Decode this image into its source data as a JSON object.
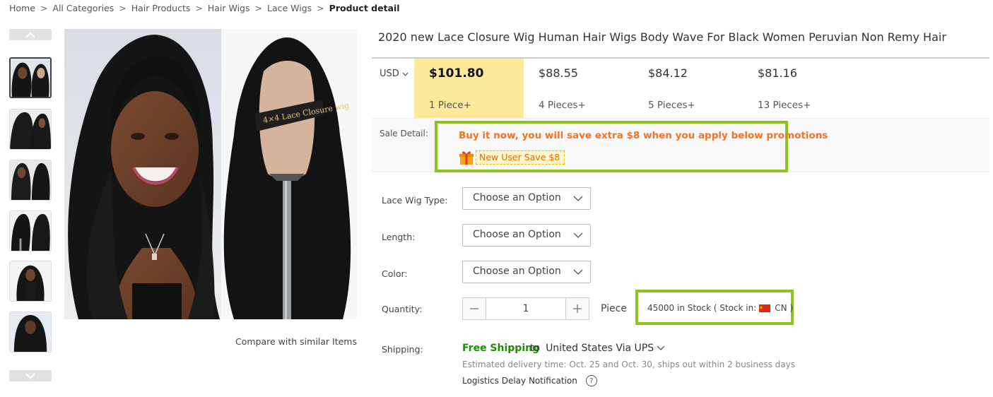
{
  "breadcrumb": {
    "items": [
      "Home",
      "All Categories",
      "Hair Products",
      "Hair Wigs",
      "Lace Wigs"
    ],
    "current": "Product detail",
    "separator": ">"
  },
  "gallery": {
    "thumbnail_count": 6,
    "active_index": 0,
    "main_image_label": "4×4 Lace Closure wig",
    "compare_link": "Compare with similar Items"
  },
  "product": {
    "title": "2020 new Lace Closure Wig Human Hair Wigs Body Wave For Black Women Peruvian Non Remy Hair"
  },
  "pricing": {
    "currency": "USD",
    "tiers": [
      {
        "price": "$101.80",
        "qty": "1 Piece+"
      },
      {
        "price": "$88.55",
        "qty": "4 Pieces+"
      },
      {
        "price": "$84.12",
        "qty": "5 Pieces+"
      },
      {
        "price": "$81.16",
        "qty": "13 Pieces+"
      }
    ],
    "highlight_color": "#fce99a"
  },
  "sale": {
    "label": "Sale Detail:",
    "promo_text": "Buy it now, you will save extra $8 when you apply below promotions",
    "coupon": "New User Save $8",
    "promo_color": "#f57224"
  },
  "options": {
    "lace_wig_type": {
      "label": "Lace Wig Type:",
      "value": "Choose an Option"
    },
    "length": {
      "label": "Length:",
      "value": "Choose an Option"
    },
    "color": {
      "label": "Color:",
      "value": "Choose an Option"
    }
  },
  "quantity": {
    "label": "Quantity:",
    "value": "1",
    "unit": "Piece",
    "stock_prefix": "45000 in Stock ( Stock in:",
    "stock_suffix": "CN )"
  },
  "shipping": {
    "label": "Shipping:",
    "free": "Free Shipping",
    "to": "to",
    "destination": "United States Via UPS",
    "delivery": "Estimated delivery time: Oct. 25 and Oct. 30, ships out within 2 business days",
    "logistics": "Logistics Delay Notification",
    "free_color": "#1a8f00"
  },
  "highlight_box_color": "#8ec21c"
}
